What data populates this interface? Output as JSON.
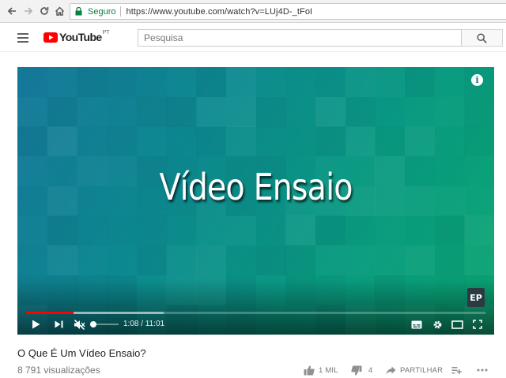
{
  "browser": {
    "secure_label": "Seguro",
    "url": "https://www.youtube.com/watch?v=LUj4D-_tFoI"
  },
  "header": {
    "logo_text": "YouTube",
    "country_code": "PT",
    "search_placeholder": "Pesquisa"
  },
  "player": {
    "video_title_overlay": "Vídeo Ensaio",
    "info_glyph": "i",
    "channel_badge": "EP",
    "current_time": "1:08",
    "duration": "11:01",
    "time_display": "1:08 / 11:01",
    "played_fraction": 0.103,
    "buffered_fraction": 0.3,
    "volume_fraction": 0.0,
    "muted": true
  },
  "video": {
    "title": "O Que É Um Vídeo Ensaio?",
    "views": "8 791 visualizações",
    "likes": "1 MIL",
    "dislikes": "4",
    "share_label": "PARTILHAR"
  },
  "colors": {
    "brand_red": "#ff0000",
    "secure_green": "#0b8043"
  }
}
